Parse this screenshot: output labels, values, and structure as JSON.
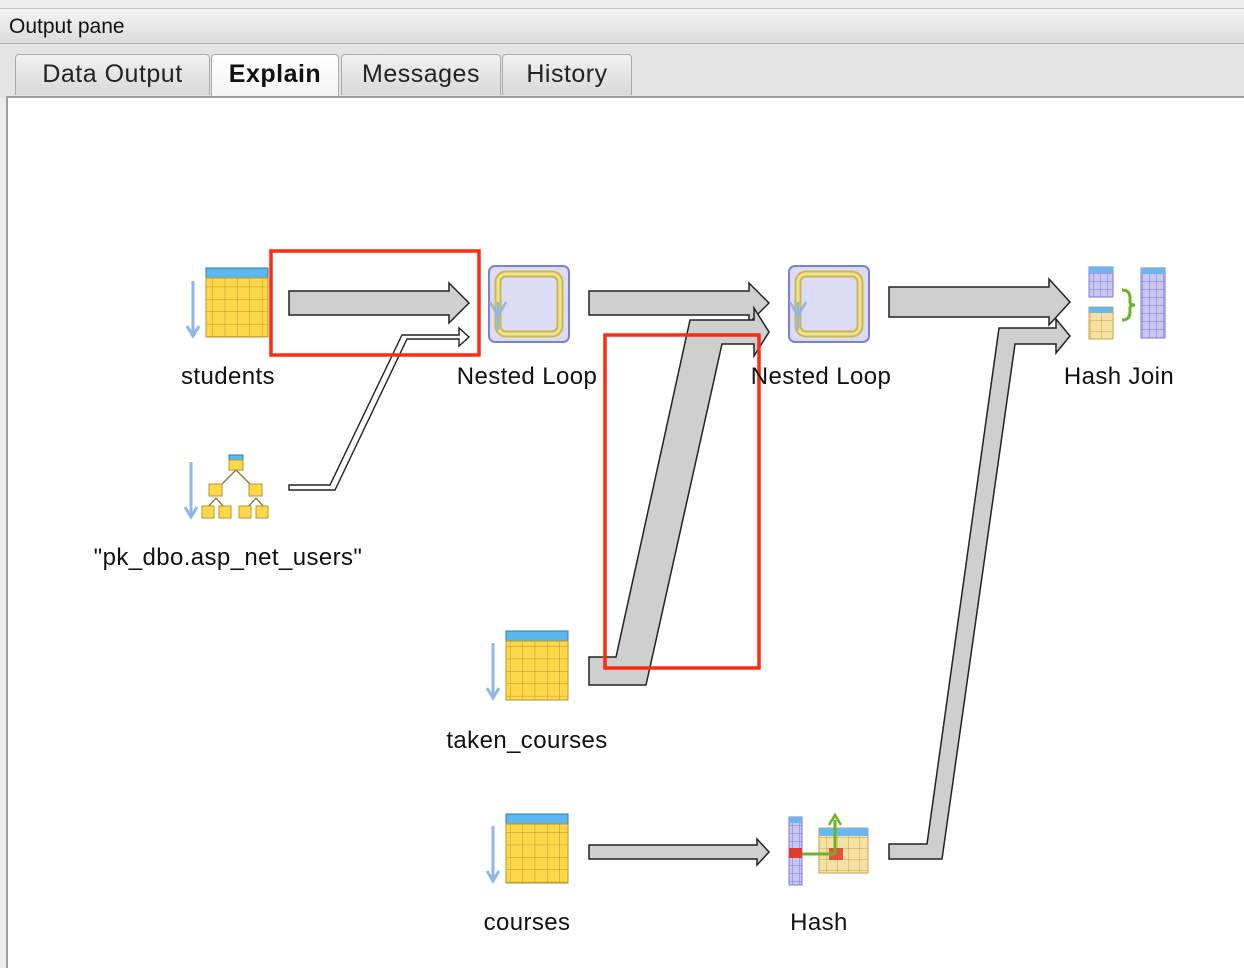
{
  "pane": {
    "title": "Output pane"
  },
  "tabs": [
    {
      "label": "Data Output",
      "active": false
    },
    {
      "label": "Explain",
      "active": true
    },
    {
      "label": "Messages",
      "active": false
    },
    {
      "label": "History",
      "active": false
    }
  ],
  "plan": {
    "nodes": {
      "students": "students",
      "pk_index": "\"pk_dbo.asp_net_users\"",
      "nested_loop_1": "Nested Loop",
      "nested_loop_2": "Nested Loop",
      "taken_courses": "taken_courses",
      "courses": "courses",
      "hash": "Hash",
      "hash_join": "Hash Join"
    }
  },
  "colors": {
    "highlight": "#ff2a12",
    "arrow_fill": "#cfcfcf",
    "arrow_stroke": "#222222"
  }
}
